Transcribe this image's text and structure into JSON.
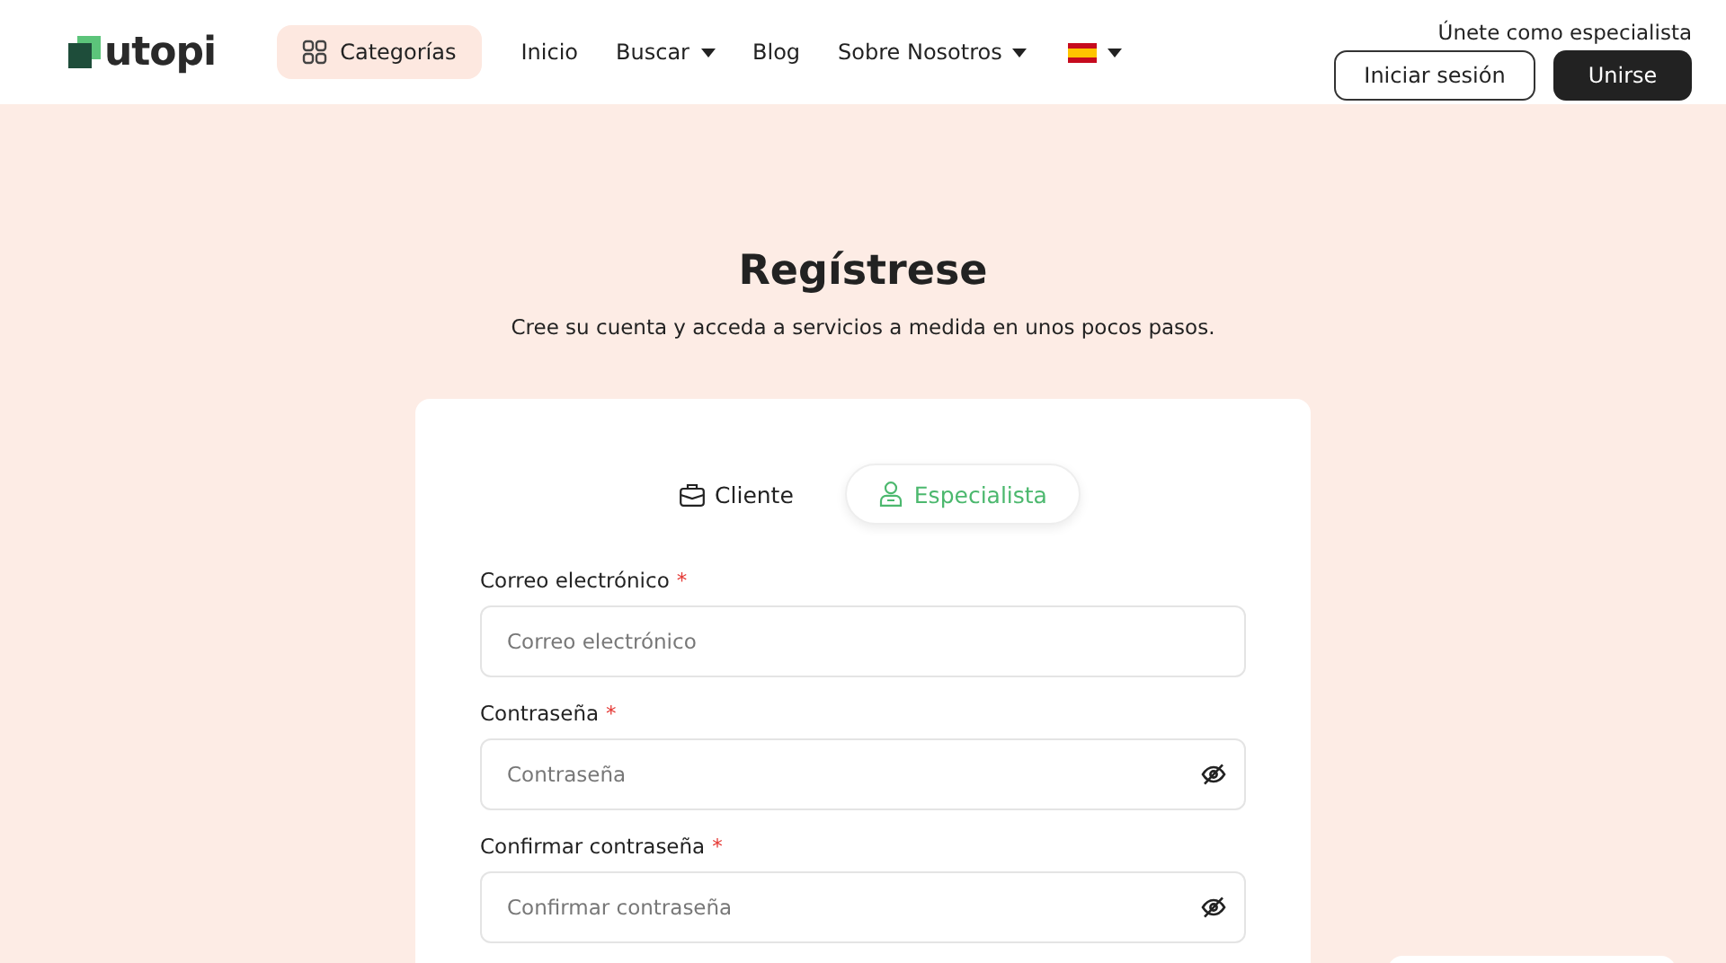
{
  "header": {
    "logo": "utopi",
    "categories": "Categorías",
    "nav": [
      {
        "label": "Inicio",
        "dropdown": false
      },
      {
        "label": "Buscar",
        "dropdown": true
      },
      {
        "label": "Blog",
        "dropdown": false
      },
      {
        "label": "Sobre Nosotros",
        "dropdown": true
      }
    ],
    "specialist_link": "Únete como especialista",
    "login": "Iniciar sesión",
    "join": "Unirse"
  },
  "title": "Regístrese",
  "subtitle": "Cree su cuenta y acceda a servicios a medida en unos pocos pasos.",
  "tabs": [
    {
      "label": "Cliente",
      "kind": "briefcase",
      "selected": false
    },
    {
      "label": "Especialista",
      "kind": "person",
      "selected": true
    }
  ],
  "fields": [
    {
      "label": "Correo electrónico",
      "required_mark": "*",
      "placeholder": "Correo electrónico",
      "kind": "text"
    },
    {
      "label": "Contraseña",
      "required_mark": "*",
      "placeholder": "Contraseña",
      "kind": "password"
    },
    {
      "label": "Confirmar contraseña",
      "required_mark": "*",
      "placeholder": "Confirmar contraseña",
      "kind": "password"
    }
  ]
}
